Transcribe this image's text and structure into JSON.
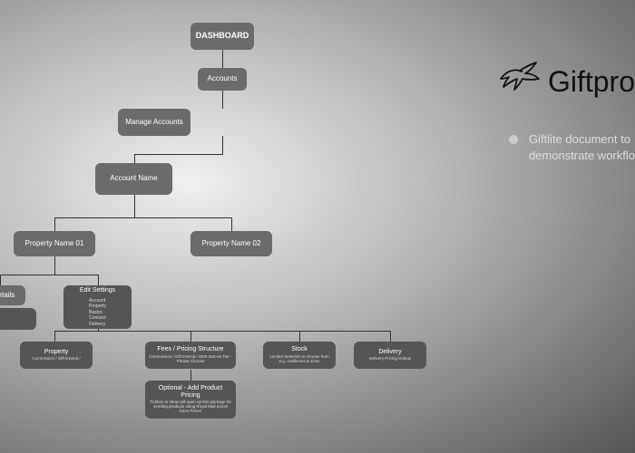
{
  "logo": {
    "text": "Giftpro"
  },
  "caption": {
    "line1": "Giftlite document to",
    "line2": "demonstrate workflo"
  },
  "nodes": {
    "dashboard": "DASHBOARD",
    "accounts": "Accounts",
    "manage_accounts": "Manage Accounts",
    "account_name": "Account Name",
    "property_01": "Property Name 01",
    "property_02": "Property Name 02",
    "details": "Details",
    "edit_settings": {
      "title": "Edit Settings",
      "items": [
        "Account",
        "Property",
        "Basics",
        "Connect",
        "Delivery"
      ]
    },
    "property_box": {
      "title": "Property",
      "sub": "Commission / Gift Extend /",
      "red": ""
    },
    "fees": {
      "title": "Fees  / Pricing Structure",
      "sub": "Commission / Gift Extend / SMS Bolt-on Tier - Please Choose",
      "red": ""
    },
    "optional": {
      "title": "Optional - Add Product Pricing",
      "sub": "Tickbox to show will open up this package for sending products using Royal Mail parcel force Prices",
      "red": ""
    },
    "stock": {
      "title": "Stock",
      "sub": "Limited Selection to choose from e.g. mailboxes & sizes",
      "red": ""
    },
    "delivery": {
      "title": "Delivery",
      "sub": "Delivery Pricing tickbox",
      "red": ""
    }
  }
}
